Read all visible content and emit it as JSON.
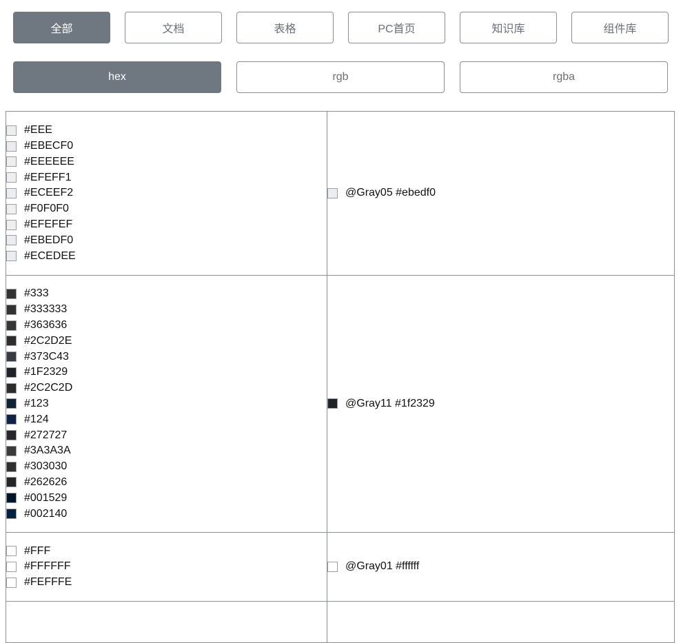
{
  "category_tabs": [
    {
      "label": "全部",
      "active": true
    },
    {
      "label": "文档",
      "active": false
    },
    {
      "label": "表格",
      "active": false
    },
    {
      "label": "PC首页",
      "active": false
    },
    {
      "label": "知识库",
      "active": false
    },
    {
      "label": "组件库",
      "active": false
    }
  ],
  "format_tabs": [
    {
      "label": "hex",
      "active": true
    },
    {
      "label": "rgb",
      "active": false
    },
    {
      "label": "rgba",
      "active": false
    }
  ],
  "groups": [
    {
      "colors": [
        "#EEE",
        "#EBECF0",
        "#EEEEEE",
        "#EFEFF1",
        "#ECEEF2",
        "#F0F0F0",
        "#EFEFEF",
        "#EBEDF0",
        "#ECEDEE"
      ],
      "variable": {
        "label": "@Gray05 #ebedf0",
        "color": "#ebedf0"
      }
    },
    {
      "colors": [
        "#333",
        "#333333",
        "#363636",
        "#2C2D2E",
        "#373C43",
        "#1F2329",
        "#2C2C2D",
        "#123",
        "#124",
        "#272727",
        "#3A3A3A",
        "#303030",
        "#262626",
        "#001529",
        "#002140"
      ],
      "variable": {
        "label": "@Gray11 #1f2329",
        "color": "#1f2329"
      }
    },
    {
      "colors": [
        "#FFF",
        "#FFFFFF",
        "#FEFFFE"
      ],
      "variable": {
        "label": "@Gray01 #ffffff",
        "color": "#ffffff"
      }
    }
  ]
}
